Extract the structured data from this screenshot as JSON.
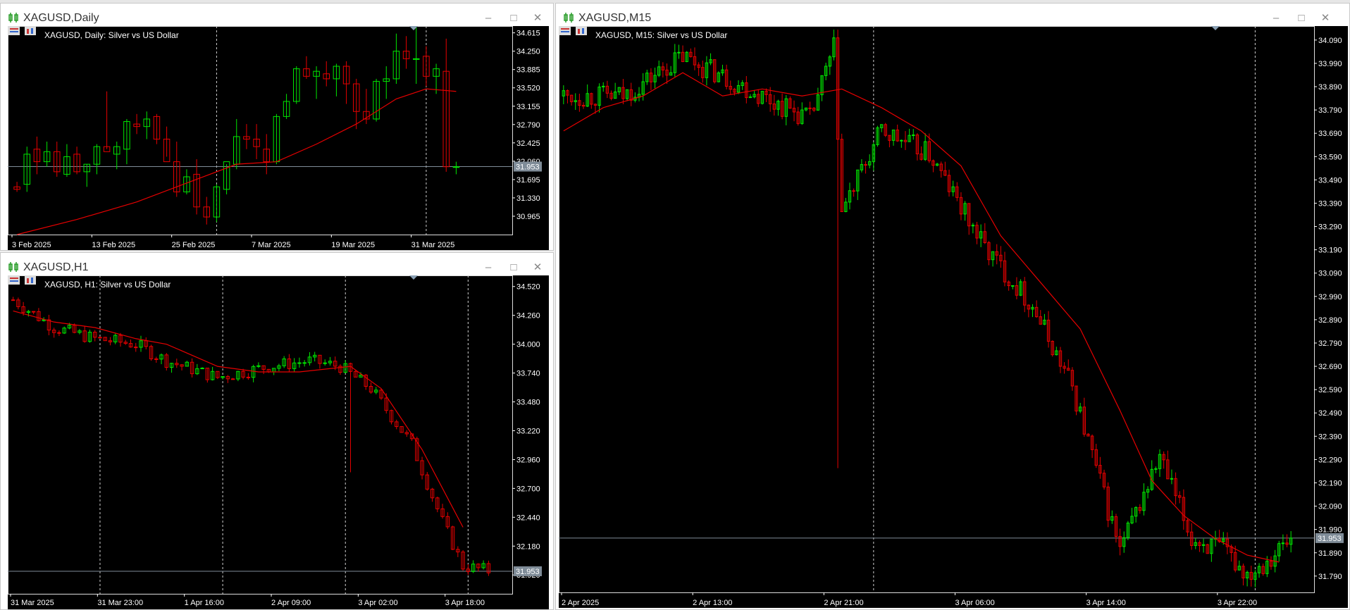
{
  "colors": {
    "bull": "#00e600",
    "bear": "#e60000",
    "ma": "#e60000",
    "bg": "#000000",
    "price_line": "#7f8c98",
    "price_box": "#7f8c98"
  },
  "windows": [
    {
      "title": "XAGUSD,Daily",
      "symbol_label": "XAGUSD, Daily:  Silver vs US Dollar",
      "current_price": "31.953",
      "chart_data": {
        "type": "candlestick",
        "symbol": "XAGUSD",
        "timeframe": "Daily",
        "y_ticks": [
          "34.615",
          "34.250",
          "33.885",
          "33.520",
          "33.155",
          "32.790",
          "32.425",
          "32.060",
          "31.695",
          "31.330",
          "30.965"
        ],
        "ylim": [
          30.6,
          34.75
        ],
        "x_labels": [
          "3 Feb 2025",
          "13 Feb 2025",
          "25 Feb 2025",
          "7 Mar 2025",
          "19 Mar 2025",
          "31 Mar 2025"
        ],
        "x_label_idx": [
          0,
          8,
          16,
          24,
          32,
          40
        ],
        "separators": [
          20,
          41
        ],
        "ma": [
          [
            0,
            30.6
          ],
          [
            6,
            30.9
          ],
          [
            12,
            31.25
          ],
          [
            18,
            31.7
          ],
          [
            22,
            32.0
          ],
          [
            26,
            32.05
          ],
          [
            30,
            32.4
          ],
          [
            34,
            32.8
          ],
          [
            38,
            33.3
          ],
          [
            41,
            33.5
          ],
          [
            44,
            33.45
          ]
        ],
        "candles": [
          [
            31.55,
            31.65,
            31.45,
            31.5
          ],
          [
            31.6,
            32.35,
            31.45,
            32.2
          ],
          [
            32.3,
            32.55,
            31.8,
            32.05
          ],
          [
            32.05,
            32.45,
            31.95,
            32.25
          ],
          [
            32.25,
            32.45,
            31.75,
            31.85
          ],
          [
            31.8,
            32.4,
            31.75,
            32.15
          ],
          [
            32.2,
            32.35,
            31.8,
            31.85
          ],
          [
            31.85,
            32.0,
            31.55,
            32.0
          ],
          [
            32.0,
            32.4,
            31.8,
            32.35
          ],
          [
            32.35,
            33.45,
            32.3,
            32.25
          ],
          [
            32.2,
            32.45,
            31.9,
            32.35
          ],
          [
            32.3,
            32.9,
            32.0,
            32.85
          ],
          [
            32.8,
            33.0,
            32.6,
            32.75
          ],
          [
            32.75,
            33.05,
            32.5,
            32.9
          ],
          [
            32.95,
            33.0,
            32.4,
            32.5
          ],
          [
            32.5,
            32.75,
            32.15,
            32.05
          ],
          [
            32.05,
            32.45,
            31.35,
            31.45
          ],
          [
            31.45,
            31.9,
            31.4,
            31.75
          ],
          [
            31.8,
            32.1,
            31.0,
            31.15
          ],
          [
            31.15,
            31.35,
            30.8,
            30.95
          ],
          [
            30.95,
            31.6,
            30.85,
            31.55
          ],
          [
            31.5,
            32.0,
            31.4,
            32.05
          ],
          [
            32.0,
            32.9,
            31.9,
            32.55
          ],
          [
            32.55,
            32.8,
            32.3,
            32.5
          ],
          [
            32.5,
            32.8,
            32.1,
            32.35
          ],
          [
            32.3,
            32.6,
            31.8,
            32.05
          ],
          [
            32.05,
            33.0,
            32.0,
            32.95
          ],
          [
            32.95,
            33.4,
            32.9,
            33.25
          ],
          [
            33.25,
            33.95,
            33.2,
            33.9
          ],
          [
            33.9,
            34.15,
            33.7,
            33.75
          ],
          [
            33.75,
            33.95,
            33.3,
            33.85
          ],
          [
            33.8,
            34.05,
            33.55,
            33.7
          ],
          [
            33.7,
            34.0,
            33.35,
            33.95
          ],
          [
            33.95,
            34.05,
            33.2,
            33.6
          ],
          [
            33.6,
            33.7,
            32.7,
            33.05
          ],
          [
            33.05,
            33.5,
            32.8,
            32.9
          ],
          [
            32.9,
            33.7,
            32.85,
            33.65
          ],
          [
            33.65,
            33.95,
            33.3,
            33.7
          ],
          [
            33.7,
            34.6,
            33.6,
            34.25
          ],
          [
            34.25,
            34.55,
            33.9,
            34.1
          ],
          [
            34.1,
            34.75,
            33.6,
            34.1
          ],
          [
            34.15,
            34.35,
            33.55,
            33.75
          ],
          [
            33.75,
            34.0,
            33.4,
            33.9
          ],
          [
            33.85,
            34.5,
            31.85,
            31.95
          ],
          [
            31.95,
            32.05,
            31.8,
            31.95
          ]
        ],
        "n": 48
      }
    },
    {
      "title": "XAGUSD,H1",
      "symbol_label": "XAGUSD, H1:  Silver vs US Dollar",
      "current_price": "31.953",
      "chart_data": {
        "type": "candlestick",
        "symbol": "XAGUSD",
        "timeframe": "H1",
        "y_ticks": [
          "34.520",
          "34.260",
          "34.000",
          "33.740",
          "33.480",
          "33.220",
          "32.960",
          "32.700",
          "32.440",
          "32.180",
          "31.920"
        ],
        "ylim": [
          31.75,
          34.62
        ],
        "x_labels": [
          "31 Mar 2025",
          "31 Mar 23:00",
          "1 Apr 16:00",
          "2 Apr 09:00",
          "3 Apr 02:00",
          "3 Apr 18:00"
        ],
        "x_label_idx": [
          0,
          17,
          34,
          51,
          68,
          85
        ],
        "separators": [
          17,
          41,
          65,
          89
        ],
        "ma": [
          [
            0,
            34.3
          ],
          [
            8,
            34.2
          ],
          [
            16,
            34.15
          ],
          [
            24,
            34.05
          ],
          [
            30,
            34.0
          ],
          [
            40,
            33.8
          ],
          [
            48,
            33.75
          ],
          [
            56,
            33.75
          ],
          [
            66,
            33.8
          ],
          [
            72,
            33.6
          ],
          [
            80,
            33.05
          ],
          [
            88,
            32.35
          ]
        ],
        "n": 94
      }
    },
    {
      "title": "XAGUSD,M15",
      "symbol_label": "XAGUSD, M15:  Silver vs US Dollar",
      "current_price": "31.953",
      "chart_data": {
        "type": "candlestick",
        "symbol": "XAGUSD",
        "timeframe": "M15",
        "y_ticks": [
          "34.090",
          "33.990",
          "33.890",
          "33.790",
          "33.690",
          "33.590",
          "33.490",
          "33.390",
          "33.290",
          "33.190",
          "33.090",
          "32.990",
          "32.890",
          "32.790",
          "32.690",
          "32.590",
          "32.490",
          "32.390",
          "32.290",
          "32.190",
          "32.090",
          "31.990",
          "31.890",
          "31.790"
        ],
        "ylim": [
          31.72,
          34.15
        ],
        "x_labels": [
          "2 Apr 2025",
          "2 Apr 13:00",
          "2 Apr 21:00",
          "3 Apr 06:00",
          "3 Apr 14:00",
          "3 Apr 22:00"
        ],
        "x_label_idx": [
          0,
          33,
          66,
          99,
          132,
          165
        ],
        "separators": [
          78,
          174
        ],
        "ma": [
          [
            0,
            33.7
          ],
          [
            10,
            33.8
          ],
          [
            20,
            33.85
          ],
          [
            30,
            33.95
          ],
          [
            40,
            33.85
          ],
          [
            50,
            33.88
          ],
          [
            60,
            33.85
          ],
          [
            70,
            33.88
          ],
          [
            80,
            33.8
          ],
          [
            90,
            33.7
          ],
          [
            100,
            33.55
          ],
          [
            110,
            33.25
          ],
          [
            120,
            33.05
          ],
          [
            130,
            32.85
          ],
          [
            140,
            32.5
          ],
          [
            148,
            32.2
          ],
          [
            156,
            32.05
          ],
          [
            164,
            31.95
          ],
          [
            172,
            31.88
          ],
          [
            180,
            31.85
          ]
        ],
        "n": 184
      }
    }
  ]
}
